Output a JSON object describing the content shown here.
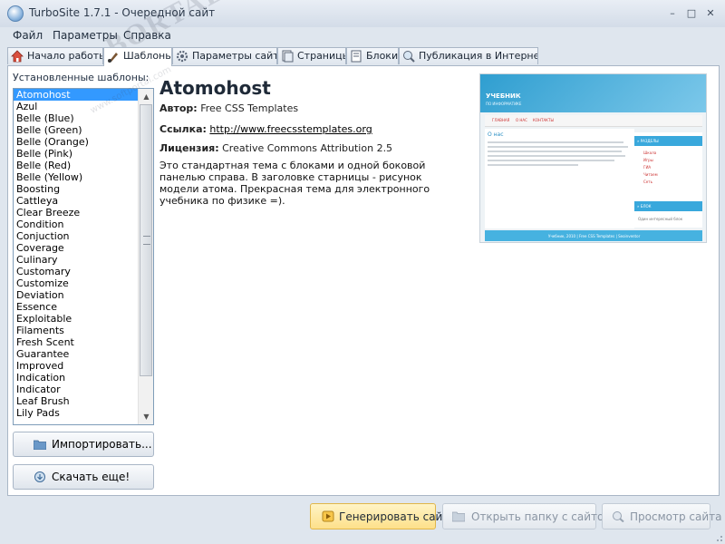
{
  "window": {
    "title": "TurboSite 1.7.1  -  Очередной сайт",
    "controls": {
      "minimize": "–",
      "maximize": "□",
      "close": "✕"
    }
  },
  "menu": {
    "items": [
      "Файл",
      "Параметры",
      "Справка"
    ]
  },
  "tabs": [
    {
      "label": "Начало работы",
      "icon": "home-icon"
    },
    {
      "label": "Шаблоны",
      "icon": "brush-icon",
      "active": true
    },
    {
      "label": "Параметры сайта",
      "icon": "gear-icon"
    },
    {
      "label": "Страницы",
      "icon": "pages-icon"
    },
    {
      "label": "Блоки",
      "icon": "blocks-icon"
    },
    {
      "label": "Публикация в Интернете",
      "icon": "globe-icon"
    }
  ],
  "templates": {
    "caption": "Установленные шаблоны:",
    "items": [
      "Atomohost",
      "Azul",
      "Belle (Blue)",
      "Belle (Green)",
      "Belle (Orange)",
      "Belle (Pink)",
      "Belle (Red)",
      "Belle (Yellow)",
      "Boosting",
      "Cattleya",
      "Clear Breeze",
      "Condition",
      "Conjuction",
      "Coverage",
      "Culinary",
      "Customary",
      "Customize",
      "Deviation",
      "Essence",
      "Exploitable",
      "Filaments",
      "Fresh Scent",
      "Guarantee",
      "Improved",
      "Indication",
      "Indicator",
      "Leaf Brush",
      "Lily Pads"
    ],
    "selected_index": 0,
    "import_label": "Импортировать...",
    "download_label": "Скачать еще!"
  },
  "details": {
    "name": "Atomohost",
    "author_label": "Автор:",
    "author": "Free CSS Templates",
    "link_label": "Ссылка:",
    "link": "http://www.freecsstemplates.org",
    "license_label": "Лицензия:",
    "license": "Creative Commons Attribution 2.5",
    "description": "Это стандартная тема с блоками и одной боковой панелью справа. В заголовке старницы - рисунок модели атома. Прекрасная тема для электронного учебника по физике =)."
  },
  "preview": {
    "title": "УЧЕБНИК",
    "subtitle": "ПО ИНФОРМАТИКЕ",
    "nav": [
      "ГЛАВНАЯ",
      "О НАС",
      "КОНТАКТЫ"
    ],
    "heading": "О нас",
    "side_head1": "» РАЗДЕЛЫ",
    "side_items": [
      "Школа",
      "Игры",
      "ГИА",
      "Читаем",
      "Сеть"
    ],
    "side_head2": "» БЛОК",
    "side_text": "Один интересный блок",
    "footer": "Учебник, 2010 | Free CSS Templates | Seoinventor"
  },
  "bottom": {
    "generate": "Генерировать сайт",
    "open_folder": "Открыть папку с сайтом",
    "view_site": "Просмотр сайта"
  },
  "watermark": {
    "text": "BORTAL",
    "sub": "www.softportal.com"
  },
  "colors": {
    "selection": "#3399ff",
    "accent_button": "#fde08a",
    "panel_bg": "#dfe6ee"
  }
}
